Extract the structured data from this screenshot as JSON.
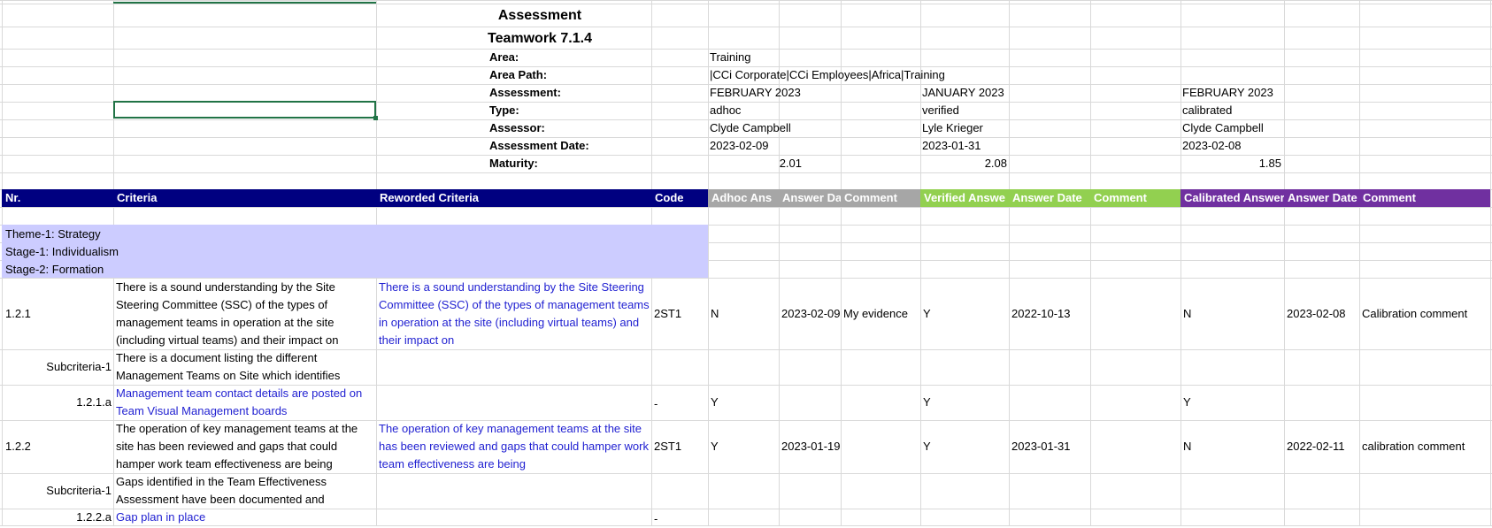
{
  "title": "Assessment",
  "subtitle": "Teamwork 7.1.4",
  "info": [
    {
      "label": "Area:",
      "values": [
        "Training",
        "",
        ""
      ]
    },
    {
      "label": "Area Path:",
      "values": [
        "|CCi Corporate|CCi Employees|Africa|Training",
        "",
        ""
      ]
    },
    {
      "label": "Assessment:",
      "values": [
        "FEBRUARY 2023",
        "JANUARY 2023",
        "FEBRUARY 2023"
      ]
    },
    {
      "label": "Type:",
      "values": [
        "adhoc",
        "verified",
        "calibrated"
      ]
    },
    {
      "label": "Assessor:",
      "values": [
        "Clyde Campbell",
        "Lyle Krieger",
        "Clyde Campbell"
      ]
    },
    {
      "label": "Assessment Date:",
      "values": [
        "2023-02-09",
        "2023-01-31",
        "2023-02-08"
      ]
    },
    {
      "label": "Maturity:",
      "values": [
        "2.01",
        "2.08",
        "1.85"
      ]
    }
  ],
  "headers": [
    "Nr.",
    "Criteria",
    "Reworded Criteria",
    "Code",
    "Adhoc Ans",
    "Answer Da",
    "Comment",
    "Verified Answe",
    "Answer Date",
    "Comment",
    "Calibrated Answer",
    "Answer Date",
    "Comment"
  ],
  "theme_lines": [
    "Theme-1: Strategy",
    "Stage-1: Individualism",
    "Stage-2: Formation"
  ],
  "rows": {
    "r1": {
      "nr": "1.2.1",
      "criteria": "There is a sound understanding by the Site Steering Committee (SSC) of the types of management teams in operation at the site (including virtual teams) and their impact on",
      "reworded": "There is a sound understanding by the Site Steering Committee (SSC) of the types of management teams in operation at the site (including virtual teams) and their impact on",
      "code": "2ST1",
      "adhoc_ans": "N",
      "adhoc_date": "2023-02-09",
      "adhoc_comment": "My evidence",
      "ver_ans": "Y",
      "ver_date": "2022-10-13",
      "ver_comment": "",
      "cal_ans": "N",
      "cal_date": "2023-02-08",
      "cal_comment": "Calibration comment"
    },
    "r2": {
      "nr": "Subcriteria-1",
      "criteria": "There is a document listing the different Management Teams on Site which identifies"
    },
    "r3": {
      "nr": "1.2.1.a",
      "criteria": "Management team contact details are posted on Team Visual Management boards",
      "code": "-",
      "adhoc_ans": "Y",
      "ver_ans": "Y",
      "cal_ans": "Y"
    },
    "r4": {
      "nr": "1.2.2",
      "criteria": "The operation of key management teams at the site has been reviewed and gaps that could hamper work team effectiveness are being",
      "reworded": "The operation of key management teams at the site has been reviewed and gaps that could hamper work team effectiveness are being",
      "code": "2ST1",
      "adhoc_ans": "Y",
      "adhoc_date": "2023-01-19",
      "adhoc_comment": "",
      "ver_ans": "Y",
      "ver_date": "2023-01-31",
      "ver_comment": "",
      "cal_ans": "N",
      "cal_date": "2022-02-11",
      "cal_comment": "calibration comment"
    },
    "r5": {
      "nr": "Subcriteria-1",
      "criteria": "Gaps identified in the Team Effectiveness Assessment have been documented and"
    },
    "r6": {
      "nr": "1.2.2.a",
      "criteria": "Gap plan in place",
      "code": "-"
    }
  },
  "colors": {
    "header_navy": "#000080",
    "header_grey": "#a6a6a6",
    "header_green": "#92d050",
    "header_purple": "#7030a0",
    "theme_fill": "#ccccff",
    "selection_border": "#217346",
    "link_blue": "#1f1fd1"
  }
}
